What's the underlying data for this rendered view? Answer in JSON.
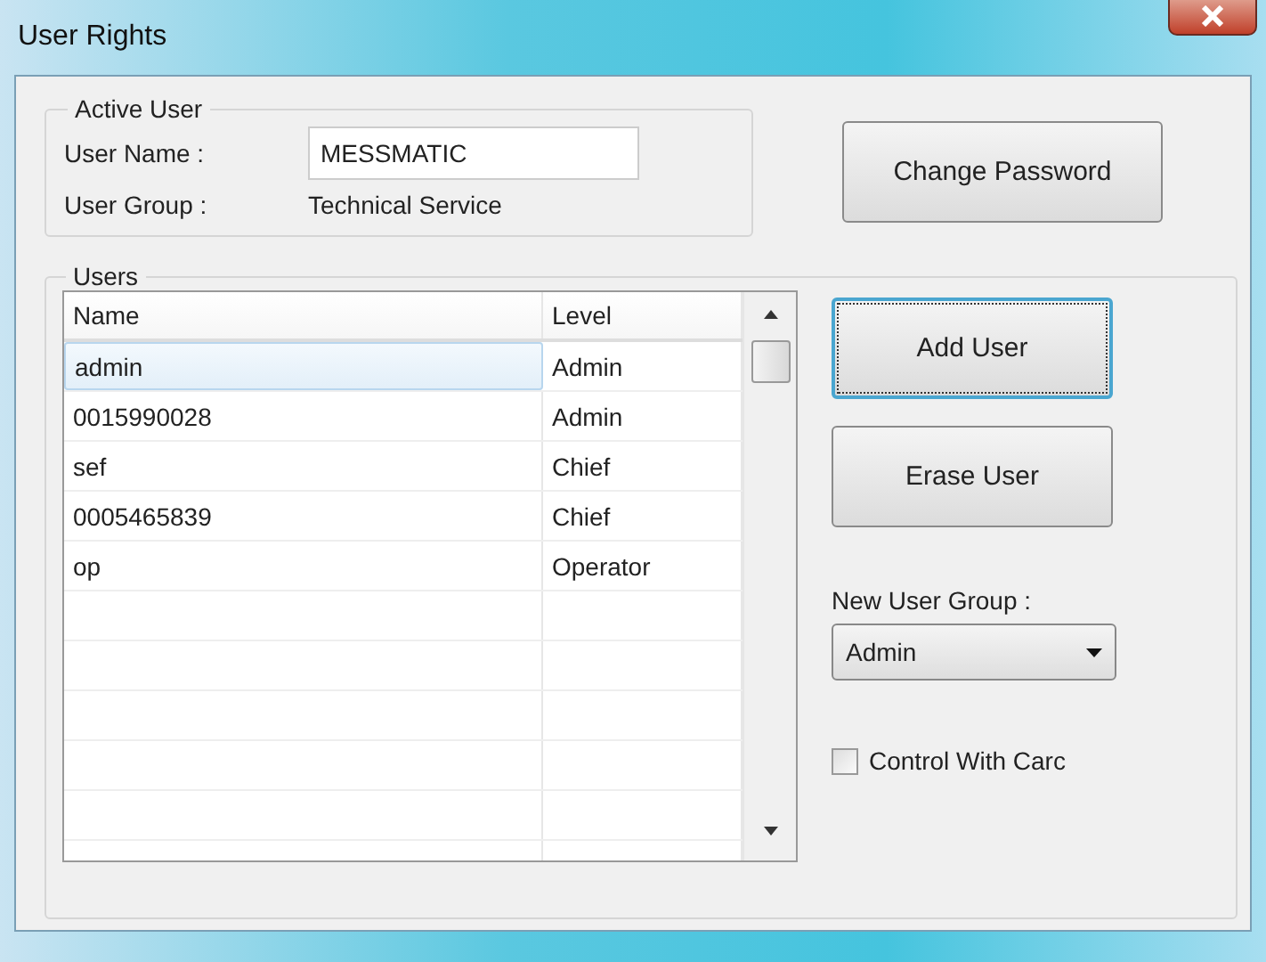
{
  "window": {
    "title": "User Rights"
  },
  "active_user": {
    "legend": "Active User",
    "user_name_label": "User Name :",
    "user_name_value": "MESSMATIC",
    "user_group_label": "User Group :",
    "user_group_value": "Technical Service"
  },
  "change_password_button": "Change Password",
  "users": {
    "legend": "Users",
    "columns": [
      "Name",
      "Level"
    ],
    "rows": [
      {
        "name": "admin",
        "level": "Admin",
        "selected": true
      },
      {
        "name": "0015990028",
        "level": "Admin",
        "selected": false
      },
      {
        "name": "sef",
        "level": "Chief",
        "selected": false
      },
      {
        "name": "0005465839",
        "level": "Chief",
        "selected": false
      },
      {
        "name": "op",
        "level": "Operator",
        "selected": false
      }
    ]
  },
  "add_user_button": {
    "label": "Add User",
    "focused": true
  },
  "erase_user_button": {
    "label": "Erase User",
    "focused": false
  },
  "new_user_group": {
    "label": "New User Group :",
    "value": "Admin"
  },
  "control_with_card": {
    "label": "Control With Carc",
    "checked": false
  }
}
